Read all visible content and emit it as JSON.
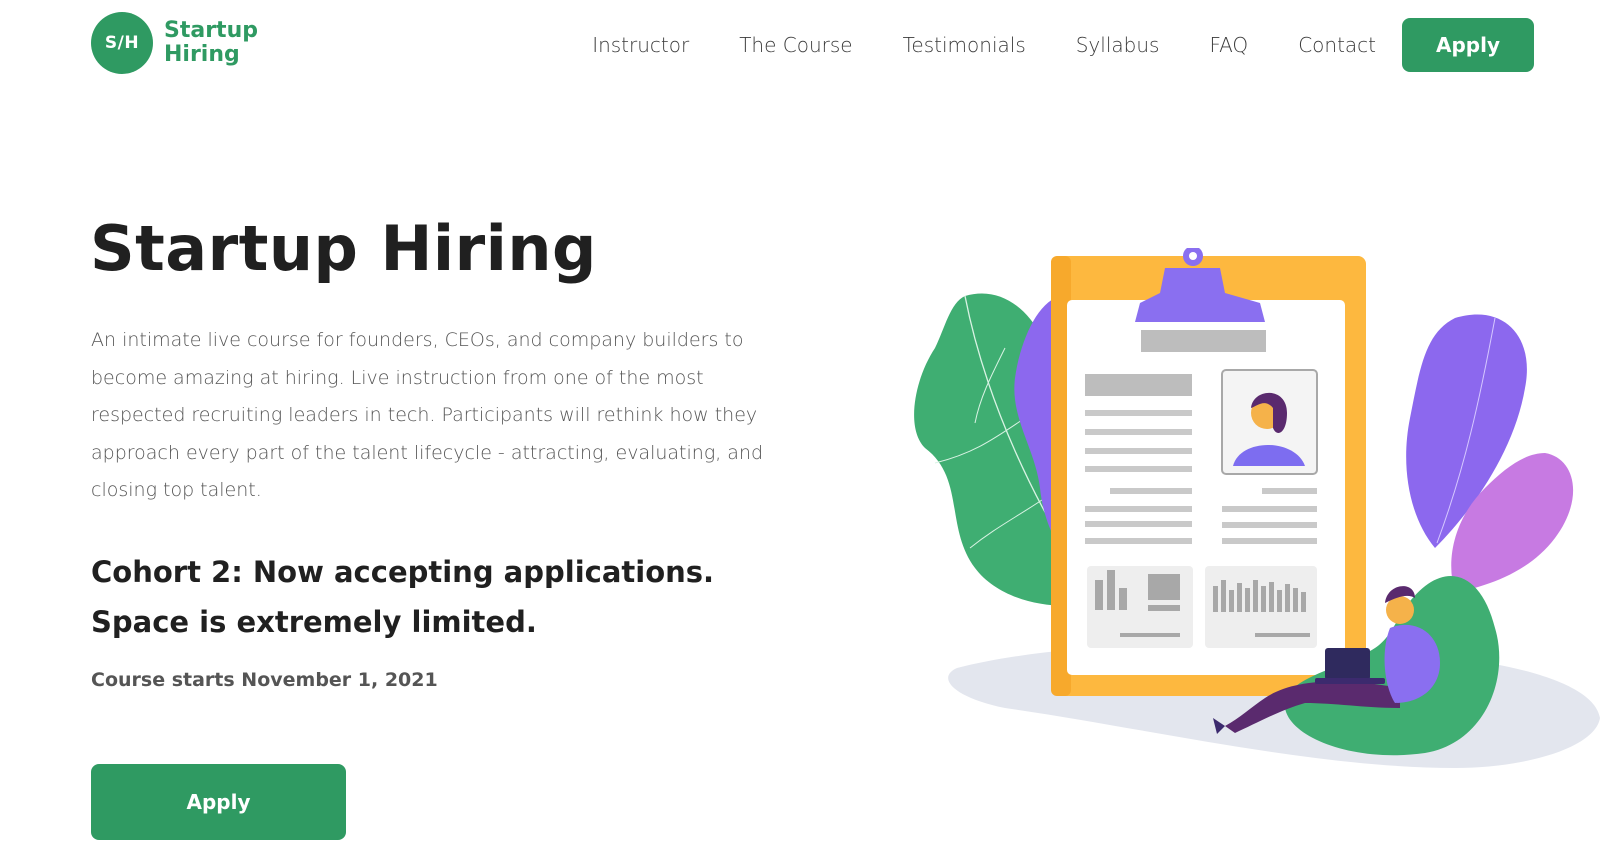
{
  "header": {
    "logo": {
      "badge": "S/H",
      "line1": "Startup",
      "line2": "Hiring"
    },
    "nav": [
      {
        "label": "Instructor"
      },
      {
        "label": "The Course"
      },
      {
        "label": "Testimonials"
      },
      {
        "label": "Syllabus"
      },
      {
        "label": "FAQ"
      },
      {
        "label": "Contact"
      }
    ],
    "apply_label": "Apply"
  },
  "hero": {
    "title": "Startup Hiring",
    "description": "An intimate live course for founders, CEOs, and company builders to become amazing at hiring. Live instruction from one of the most respected recruiting leaders in tech. Participants will rethink how they approach every part of the talent lifecycle - attracting, evaluating, and closing top talent.",
    "cohort": "Cohort 2: Now accepting applications. Space is extremely limited.",
    "start_date": "Course starts November 1, 2021",
    "apply_label": "Apply"
  },
  "colors": {
    "brand_green": "#2f9a62",
    "heading": "#202020",
    "body_text": "#555555",
    "clipboard_orange": "#fdb83f",
    "clip_purple": "#8a6ff0"
  },
  "illustration": {
    "icon": "resume-clipboard-illustration"
  }
}
